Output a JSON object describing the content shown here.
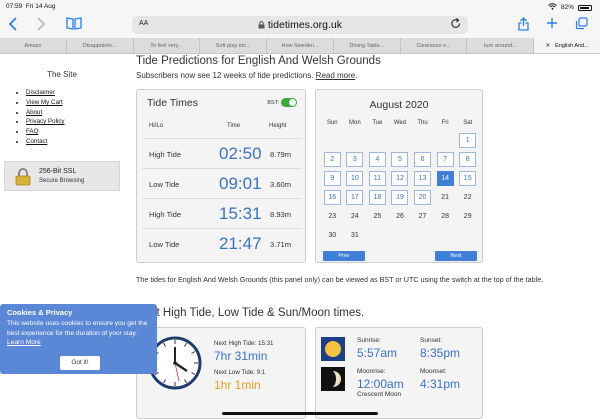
{
  "status": {
    "time": "07:59",
    "date": "Fri 14 Aug",
    "battery": "82%"
  },
  "browser": {
    "text_size": "AA",
    "url": "tidetimes.org.uk",
    "tabs": [
      "Amazo",
      "Disappointe...",
      "To feel very...",
      "Soft play etc...",
      "How Sweden...",
      "Dining Table...",
      "Clearance o...",
      "turn around...",
      "English And..."
    ]
  },
  "sidebar": {
    "title": "The Site",
    "links": [
      "Disclaimer",
      "View My Cart",
      "About",
      "Privacy Policy",
      "FAQ",
      "Contact"
    ],
    "ssl_title": "256-Bit SSL",
    "ssl_sub": "Secure Browsing"
  },
  "page": {
    "title": "Tide Predictions for English And Welsh Grounds",
    "subtitle": "Subscribers now see 12 weeks of tide predictions.",
    "subtitle_link": "Read more",
    "subtitle_end": ".",
    "description": "The tides for English And Welsh Grounds (this panel only) can be viewed as BST or UTC using the switch at the top of the table.",
    "next_heading": "Next High Tide, Low Tide & Sun/Moon times."
  },
  "tide_table": {
    "heading": "Tide Times",
    "bst_label": "BST:",
    "col_hilo": "Hi/Lo",
    "col_time": "Time",
    "col_height": "Height",
    "rows": [
      {
        "type": "High Tide",
        "time": "02:50",
        "height": "8.79m"
      },
      {
        "type": "Low Tide",
        "time": "09:01",
        "height": "3.60m"
      },
      {
        "type": "High Tide",
        "time": "15:31",
        "height": "8.93m"
      },
      {
        "type": "Low Tide",
        "time": "21:47",
        "height": "3.71m"
      }
    ]
  },
  "calendar": {
    "title": "August 2020",
    "days": [
      "Sun",
      "Mon",
      "Tue",
      "Wed",
      "Thu",
      "Fri",
      "Sat"
    ],
    "lead_blanks": 6,
    "count": 31,
    "linked_through": 20,
    "selected": 14,
    "prev": "Prev",
    "next": "Next"
  },
  "next_tides": {
    "high_label": "Next High Tide: 15:31",
    "high_value": "7hr 31min",
    "low_label": "Next Low Tide: 9:1",
    "low_value": "1hr 1min"
  },
  "sun_moon": {
    "sunrise_label": "Sunrise:",
    "sunrise": "5:57am",
    "sunset_label": "Sunset:",
    "sunset": "8:35pm",
    "moonrise_label": "Moonrise:",
    "moonrise": "12:00am",
    "moonset_label": "Moonset:",
    "moonset": "4:31pm",
    "moon_phase": "Crescent Moon"
  },
  "cookie": {
    "title": "Cookies & Privacy",
    "body": "This website uses cookies to ensure you get the best experience for the duration of your stay.",
    "learn_more": "Learn More",
    "button": "Got it!"
  },
  "colors": {
    "accent": "#3a72c8",
    "low_tide_countdown": "#e89e1b",
    "toggle_on": "#3aa83a",
    "cookie_bg": "#5a87d6"
  }
}
